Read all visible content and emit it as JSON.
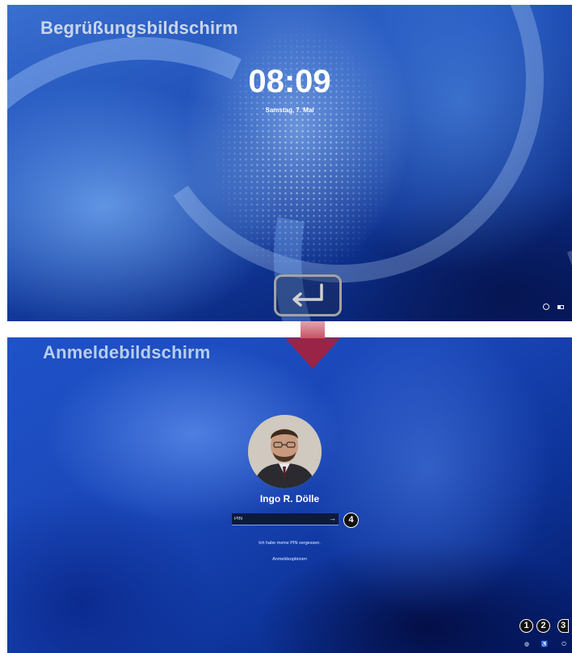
{
  "lock_screen": {
    "section_label": "Begrüßungsbildschirm",
    "time": "08:09",
    "date": "Samstag, 7. Mai",
    "status_icons": [
      "network-icon",
      "battery-icon"
    ]
  },
  "transition": {
    "enter_key_icon": "enter-key-icon",
    "arrow_color": "#a8203a"
  },
  "login_screen": {
    "section_label": "Anmeldebildschirm",
    "user_name": "Ingo R. Dölle",
    "pin_placeholder": "PIN",
    "submit_icon": "→",
    "forgot_pin_link": "Ich habe meine PIN vergessen.",
    "signin_options_link": "Anmeldeoptionen",
    "callouts": {
      "pin": "4",
      "network": "1",
      "accessibility": "2",
      "power": "3"
    },
    "tray_icons": {
      "network": "◍",
      "accessibility": "♿",
      "power": "⏻"
    }
  },
  "colors": {
    "label_top": "#c9d6ea",
    "label_bottom": "#b7cdf0",
    "pin_box": "#0e1a3c"
  }
}
